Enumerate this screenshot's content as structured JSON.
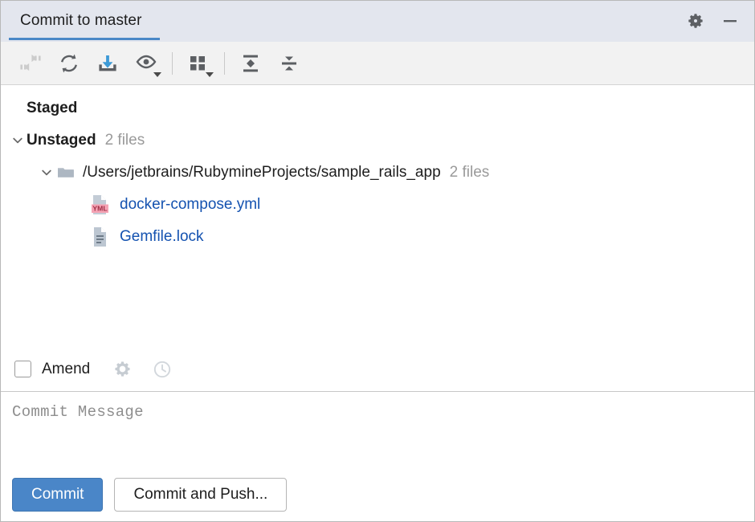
{
  "window": {
    "tab_label": "Commit to master",
    "settings_icon": "gear-icon",
    "minimize_icon": "minimize-icon",
    "accent_color": "#4a88c7",
    "tab_background": "#e3e6ee"
  },
  "toolbar": {
    "items": [
      {
        "name": "collapse-arrows-icon",
        "label": "Unstage",
        "disabled": true,
        "has_dropdown": false
      },
      {
        "name": "refresh-icon",
        "label": "Refresh",
        "disabled": false,
        "has_dropdown": false
      },
      {
        "name": "download-icon",
        "label": "Update",
        "disabled": false,
        "has_dropdown": false
      },
      {
        "name": "eye-icon",
        "label": "Preview Diff",
        "disabled": false,
        "has_dropdown": true
      },
      {
        "name": "group-by-icon",
        "label": "Group By",
        "disabled": false,
        "has_dropdown": true
      },
      {
        "name": "expand-all-icon",
        "label": "Expand All",
        "disabled": false,
        "has_dropdown": false
      },
      {
        "name": "collapse-all-icon",
        "label": "Collapse All",
        "disabled": false,
        "has_dropdown": false
      }
    ]
  },
  "tree": {
    "staged": {
      "label": "Staged",
      "count": ""
    },
    "unstaged": {
      "label": "Unstaged",
      "count": "2 files",
      "expanded": true,
      "folder": {
        "path": "/Users/jetbrains/RubymineProjects/sample_rails_app",
        "count": "2 files",
        "expanded": true,
        "files": [
          {
            "name": "docker-compose.yml",
            "icon": "yml-file-icon",
            "badge": "YML"
          },
          {
            "name": "Gemfile.lock",
            "icon": "text-file-icon",
            "badge": ""
          }
        ]
      }
    },
    "link_color": "#1452b0",
    "muted_color": "#9a9a9a"
  },
  "amend": {
    "label": "Amend",
    "checked": false,
    "settings_icon": "gear-icon",
    "history_icon": "clock-icon"
  },
  "commit_message": {
    "value": "",
    "placeholder": "Commit Message"
  },
  "buttons": {
    "commit": "Commit",
    "commit_and_push": "Commit and Push...",
    "primary_color": "#4a86c8"
  }
}
